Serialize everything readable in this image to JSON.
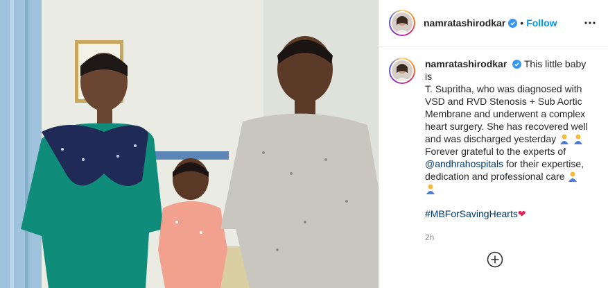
{
  "post": {
    "username": "namratashirodkar",
    "follow_label": "Follow",
    "separator": "•",
    "caption_lines": [
      "This little baby is",
      "T. Supritha, who was diagnosed with",
      "VSD and RVD Stenosis + Sub Aortic",
      "Membrane and underwent a complex",
      "heart surgery. She has recovered well",
      "and was discharged yesterday",
      "Forever grateful to the experts of",
      "for their expertise,",
      "dedication and professional care"
    ],
    "mention": "@andhrahospitals",
    "hashtag": "#MBForSavingHearts",
    "heart_emoji": "❤",
    "time_ago": "2h"
  },
  "icons": {
    "verified": "verified-badge-icon",
    "more": "more-options-icon",
    "add_comment": "plus-circle-icon",
    "emoji": "folded-hands-emoji"
  },
  "colors": {
    "follow": "#0095f6",
    "link": "#00376b",
    "muted": "#8e8e8e",
    "verified": "#3897f0"
  }
}
